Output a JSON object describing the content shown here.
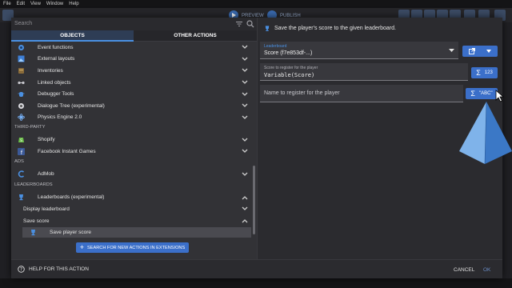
{
  "menubar": {
    "items": [
      "File",
      "Edit",
      "View",
      "Window",
      "Help"
    ]
  },
  "toolbar": {
    "preview_label": "PREVIEW",
    "publish_label": "PUBLISH"
  },
  "search": {
    "placeholder": "Search"
  },
  "tabs": [
    "OBJECTS",
    "OTHER ACTIONS"
  ],
  "list": {
    "items_top": [
      {
        "label": "Event functions",
        "icon": "event-functions-icon"
      },
      {
        "label": "External layouts",
        "icon": "external-layouts-icon"
      },
      {
        "label": "Inventories",
        "icon": "inventories-icon"
      },
      {
        "label": "Linked objects",
        "icon": "linked-objects-icon"
      },
      {
        "label": "Debugger Tools",
        "icon": "debugger-icon"
      },
      {
        "label": "Dialogue Tree (experimental)",
        "icon": "dialogue-tree-icon"
      },
      {
        "label": "Physics Engine 2.0",
        "icon": "physics-icon"
      }
    ],
    "section_thirdparty": "THIRD-PARTY",
    "items_thirdparty": [
      {
        "label": "Shopify",
        "icon": "shopify-icon"
      },
      {
        "label": "Facebook Instant Games",
        "icon": "facebook-icon"
      }
    ],
    "section_ads": "ADS",
    "items_ads": [
      {
        "label": "AdMob",
        "icon": "admob-icon"
      }
    ],
    "section_leaderboards": "LEADERBOARDS",
    "leaderboards_label": "Leaderboards (experimental)",
    "display_leaderboard": "Display leaderboard",
    "save_score": "Save score",
    "save_player_score": "Save player score"
  },
  "extensions_button": "SEARCH FOR NEW ACTIONS IN EXTENSIONS",
  "right": {
    "description": "Save the player's score to the given leaderboard.",
    "leaderboard_label": "Leaderboard",
    "leaderboard_value": "Score (f7e853df-...)",
    "score_label": "Score to register for the player",
    "score_value": "Variable(Score)",
    "score_btn": "123",
    "name_placeholder": "Name to register for the player",
    "name_btn": "\"ABC\""
  },
  "footer": {
    "help": "HELP FOR THIS ACTION",
    "cancel": "CANCEL",
    "ok": "OK"
  },
  "colors": {
    "accent": "#3b6fc9",
    "dialog_bg": "#2b2b2f",
    "pane_bg": "#323236",
    "pyramid": "#4a90e2"
  }
}
